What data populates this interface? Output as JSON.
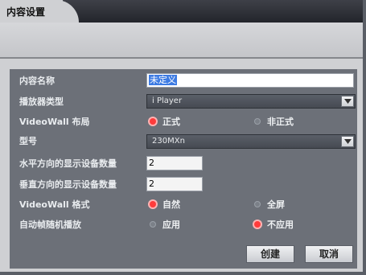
{
  "tab": {
    "title": "内容设置"
  },
  "form": {
    "content_name": {
      "label": "内容名称",
      "value": "未定义"
    },
    "player_type": {
      "label": "播放器类型",
      "selected": "i Player"
    },
    "videowall_layout": {
      "label": "VideoWall 布局",
      "options": [
        "正式",
        "非正式"
      ],
      "selected": "正式"
    },
    "model": {
      "label": "型号",
      "selected": "230MXn"
    },
    "h_count": {
      "label": "水平方向的显示设备数量",
      "value": "2"
    },
    "v_count": {
      "label": "垂直方向的显示设备数量",
      "value": "2"
    },
    "videowall_format": {
      "label": "VideoWall 格式",
      "options": [
        "自然",
        "全屏"
      ],
      "selected": "自然"
    },
    "auto_play": {
      "label": "自动帧随机播放",
      "options": [
        "应用",
        "不应用"
      ],
      "selected": "不应用"
    }
  },
  "buttons": {
    "create": "创建",
    "cancel": "取消"
  },
  "colors": {
    "panel": "#6c7078",
    "radio_on": "#ff3b3b",
    "selection": "#3d7be3"
  }
}
